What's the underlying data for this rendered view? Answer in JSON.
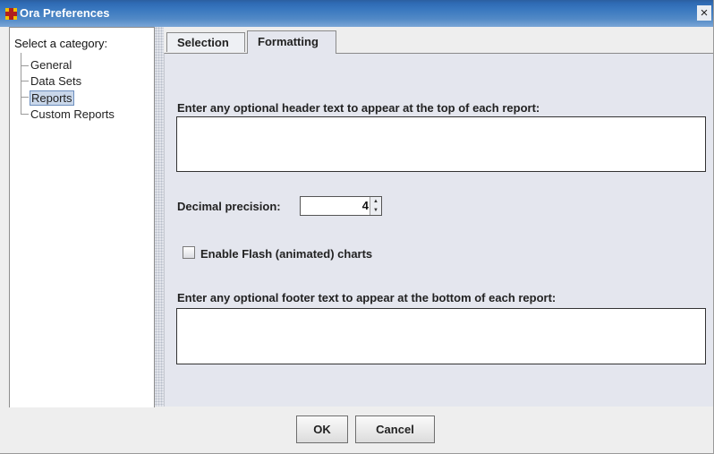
{
  "window": {
    "title": "Ora Preferences",
    "close_glyph": "×"
  },
  "sidebar": {
    "root_label": "Select a category:",
    "items": [
      {
        "label": "General"
      },
      {
        "label": "Data Sets"
      },
      {
        "label": "Reports",
        "selected": true
      },
      {
        "label": "Custom Reports"
      }
    ]
  },
  "tabs": [
    {
      "label": "Selection",
      "active": false
    },
    {
      "label": "Formatting",
      "active": true
    }
  ],
  "formatting": {
    "header_label": "Enter any optional header text to appear at the top of each report:",
    "header_value": "",
    "decimal_label": "Decimal precision:",
    "decimal_value": "4",
    "flash_label": "Enable Flash (animated) charts",
    "flash_checked": false,
    "footer_label": "Enter any optional footer text to appear at the bottom of each report:",
    "footer_value": ""
  },
  "buttons": {
    "ok": "OK",
    "cancel": "Cancel"
  },
  "icons": {
    "app": "ora-app-icon",
    "close": "close-icon",
    "spin_up": "spinner-up-icon",
    "spin_down": "spinner-down-icon"
  },
  "colors": {
    "titlebar": "#3a78bf",
    "panel": "#e4e6ee",
    "selection": "#c9d7ea"
  }
}
